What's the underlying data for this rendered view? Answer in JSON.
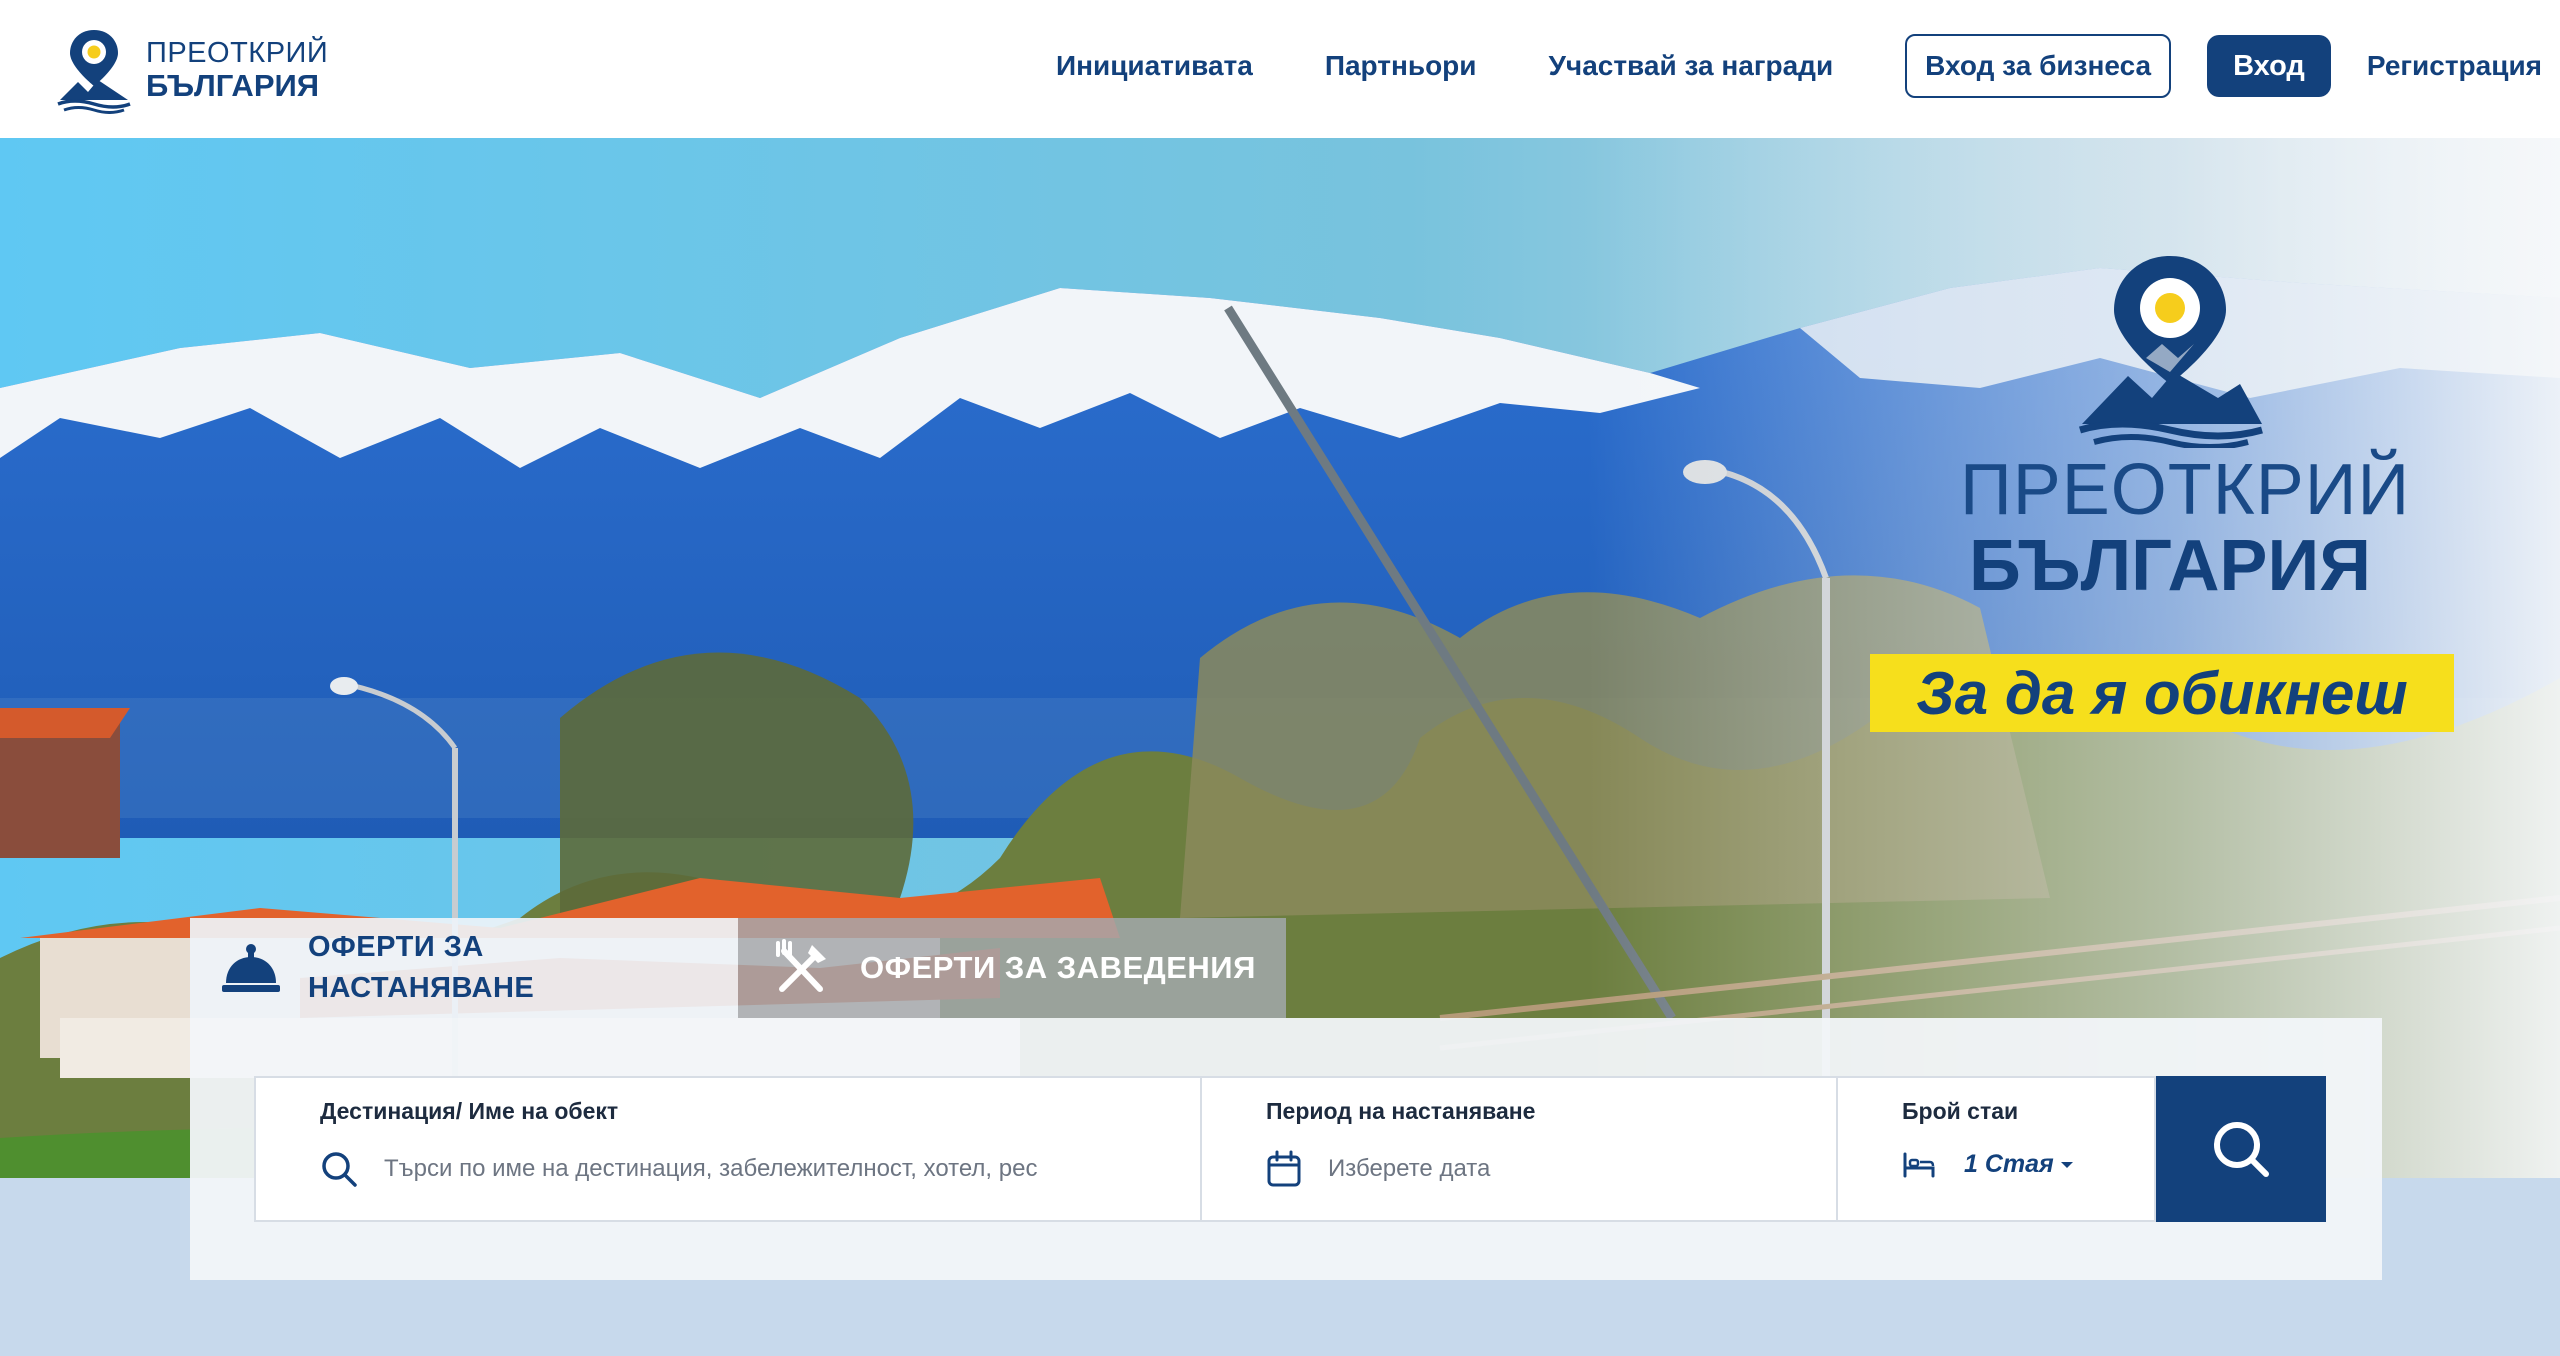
{
  "brand": {
    "line1": "ПРЕОТКРИЙ",
    "line2": "БЪЛГАРИЯ"
  },
  "nav": {
    "initiative": "Инициативата",
    "partners": "Партньори",
    "prizes": "Участвай за награди",
    "business_login": "Вход за бизнеса",
    "login": "Вход",
    "register": "Регистрация"
  },
  "hero": {
    "logo_line1": "ПРЕОТКРИЙ",
    "logo_line2": "БЪЛГАРИЯ",
    "tagline": "За да я обикнеш"
  },
  "search": {
    "tabs": [
      {
        "label_line1": "ОФЕРТИ ЗА",
        "label_line2": "НАСТАНЯВАНЕ",
        "icon": "reception-bell-icon",
        "active": true
      },
      {
        "label": "ОФЕРТИ ЗА ЗАВЕДЕНИЯ",
        "icon": "fork-knife-icon",
        "active": false
      }
    ],
    "destination": {
      "label": "Дестинация/ Име на обект",
      "placeholder": "Търси по име на дестинация, забележителност, хотел, рес"
    },
    "period": {
      "label": "Период на настаняване",
      "placeholder": "Изберете дата"
    },
    "rooms": {
      "label": "Брой стаи",
      "value": "1 Стая"
    }
  },
  "colors": {
    "brand_blue": "#13417c",
    "tagline_yellow": "#f6df1c",
    "header_bg": "#ffffff"
  }
}
